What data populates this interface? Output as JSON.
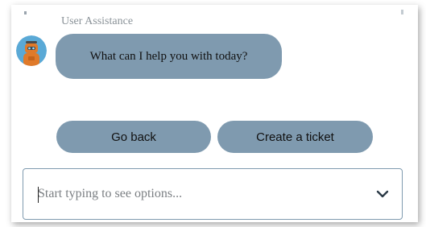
{
  "chat": {
    "sender_name": "User Assistance",
    "message": "What can I help you with today?"
  },
  "actions": {
    "go_back_label": "Go back",
    "create_ticket_label": "Create a ticket"
  },
  "composer": {
    "placeholder": "Start typing to see options...",
    "value": ""
  },
  "icons": {
    "avatar": "robot-avatar-icon",
    "dropdown": "chevron-down-icon"
  },
  "colors": {
    "accent": "#7f9aaf",
    "avatar_bg": "#5aa9d6",
    "robot": "#e07a2a"
  }
}
